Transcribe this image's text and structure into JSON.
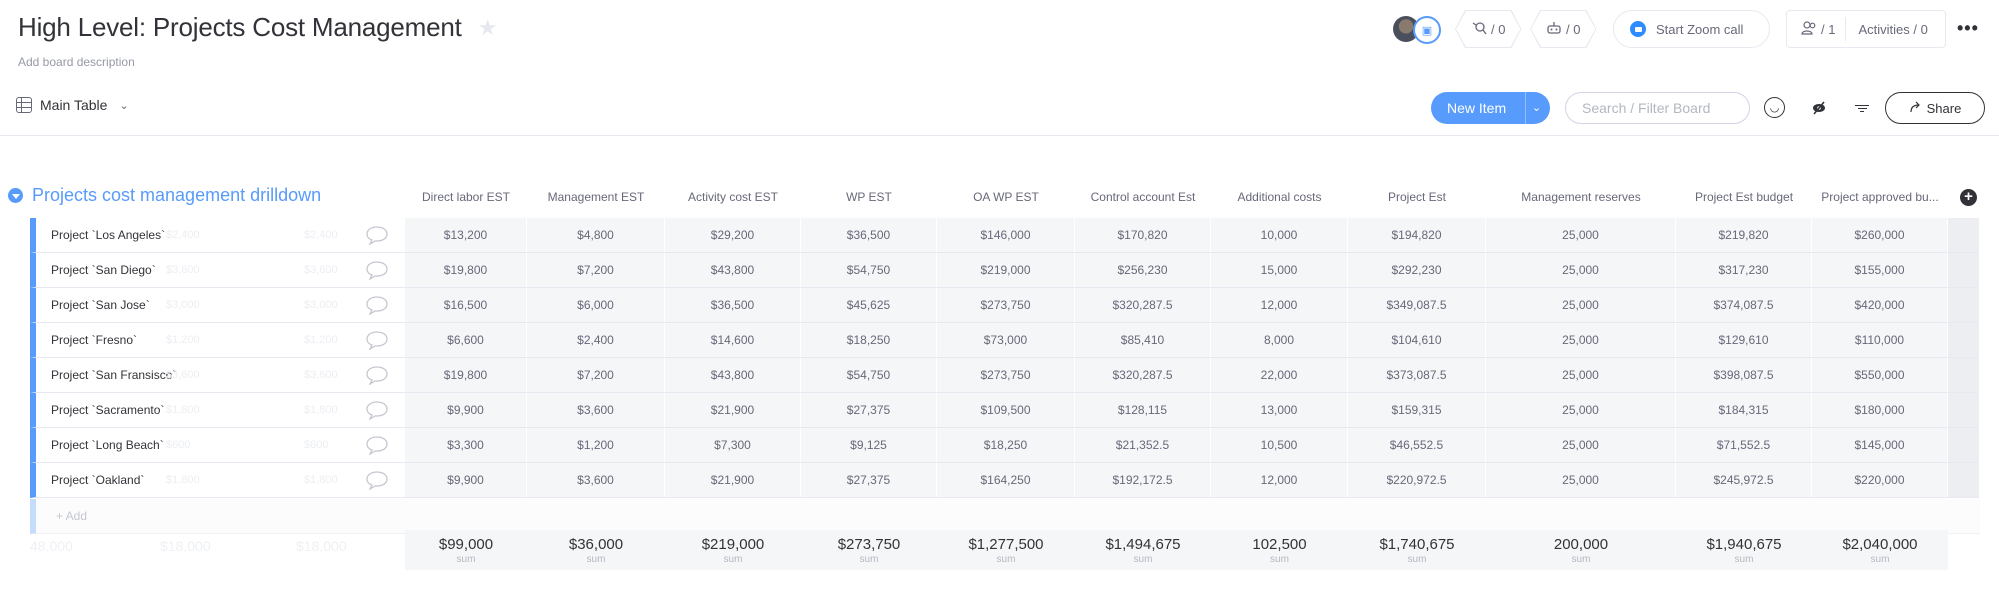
{
  "header": {
    "title": "High Level: Projects Cost Management",
    "description_placeholder": "Add board description",
    "star_icon": "star-icon",
    "integrations_count": "/ 0",
    "automations_count": "/ 0",
    "zoom_label": "Start Zoom call",
    "members_count": "/ 1",
    "activities_label": "Activities / 0",
    "more_label": "•••"
  },
  "toolbar": {
    "view_label": "Main Table",
    "new_item_label": "New Item",
    "search_placeholder": "Search / Filter Board",
    "share_label": "Share"
  },
  "group": {
    "title": "Projects cost management drilldown",
    "color": "#579bfc",
    "add_label": "+ Add",
    "columns": [
      "Direct labor EST",
      "Management EST",
      "Activity cost EST",
      "WP EST",
      "OA WP EST",
      "Control account Est",
      "Additional costs",
      "Project Est",
      "Management reserves",
      "Project Est budget",
      "Project approved bu..."
    ],
    "rows": [
      {
        "name": "Project `Los Angeles`",
        "ghost": [
          "$2,400",
          "$2,400"
        ],
        "values": [
          "$13,200",
          "$4,800",
          "$29,200",
          "$36,500",
          "$146,000",
          "$170,820",
          "10,000",
          "$194,820",
          "25,000",
          "$219,820",
          "$260,000"
        ]
      },
      {
        "name": "Project `San Diego`",
        "ghost": [
          "$3,600",
          "$3,600"
        ],
        "values": [
          "$19,800",
          "$7,200",
          "$43,800",
          "$54,750",
          "$219,000",
          "$256,230",
          "15,000",
          "$292,230",
          "25,000",
          "$317,230",
          "$155,000"
        ]
      },
      {
        "name": "Project `San Jose`",
        "ghost": [
          "$3,000",
          "$3,000"
        ],
        "values": [
          "$16,500",
          "$6,000",
          "$36,500",
          "$45,625",
          "$273,750",
          "$320,287.5",
          "12,000",
          "$349,087.5",
          "25,000",
          "$374,087.5",
          "$420,000"
        ]
      },
      {
        "name": "Project `Fresno`",
        "ghost": [
          "$1,200",
          "$1,200"
        ],
        "values": [
          "$6,600",
          "$2,400",
          "$14,600",
          "$18,250",
          "$73,000",
          "$85,410",
          "8,000",
          "$104,610",
          "25,000",
          "$129,610",
          "$110,000"
        ]
      },
      {
        "name": "Project `San Fransisco`",
        "ghost": [
          "$3,600",
          "$3,600"
        ],
        "values": [
          "$19,800",
          "$7,200",
          "$43,800",
          "$54,750",
          "$273,750",
          "$320,287.5",
          "22,000",
          "$373,087.5",
          "25,000",
          "$398,087.5",
          "$550,000"
        ]
      },
      {
        "name": "Project `Sacramento`",
        "ghost": [
          "$1,800",
          "$1,800"
        ],
        "values": [
          "$9,900",
          "$3,600",
          "$21,900",
          "$27,375",
          "$109,500",
          "$128,115",
          "13,000",
          "$159,315",
          "25,000",
          "$184,315",
          "$180,000"
        ]
      },
      {
        "name": "Project `Long Beach`",
        "ghost": [
          "$600",
          "$600"
        ],
        "values": [
          "$3,300",
          "$1,200",
          "$7,300",
          "$9,125",
          "$18,250",
          "$21,352.5",
          "10,500",
          "$46,552.5",
          "25,000",
          "$71,552.5",
          "$145,000"
        ]
      },
      {
        "name": "Project `Oakland`",
        "ghost": [
          "$1,800",
          "$1,800"
        ],
        "values": [
          "$9,900",
          "$3,600",
          "$21,900",
          "$27,375",
          "$164,250",
          "$192,172.5",
          "12,000",
          "$220,972.5",
          "25,000",
          "$245,972.5",
          "$220,000"
        ]
      }
    ],
    "summary": [
      {
        "value": "$99,000",
        "label": "sum"
      },
      {
        "value": "$36,000",
        "label": "sum"
      },
      {
        "value": "$219,000",
        "label": "sum"
      },
      {
        "value": "$273,750",
        "label": "sum"
      },
      {
        "value": "$1,277,500",
        "label": "sum"
      },
      {
        "value": "$1,494,675",
        "label": "sum"
      },
      {
        "value": "102,500",
        "label": "sum"
      },
      {
        "value": "$1,740,675",
        "label": "sum"
      },
      {
        "value": "200,000",
        "label": "sum"
      },
      {
        "value": "$1,940,675",
        "label": "sum"
      },
      {
        "value": "$2,040,000",
        "label": "sum"
      }
    ],
    "ghost_summary": [
      "48,000",
      "$18,000",
      "$18,000"
    ]
  }
}
